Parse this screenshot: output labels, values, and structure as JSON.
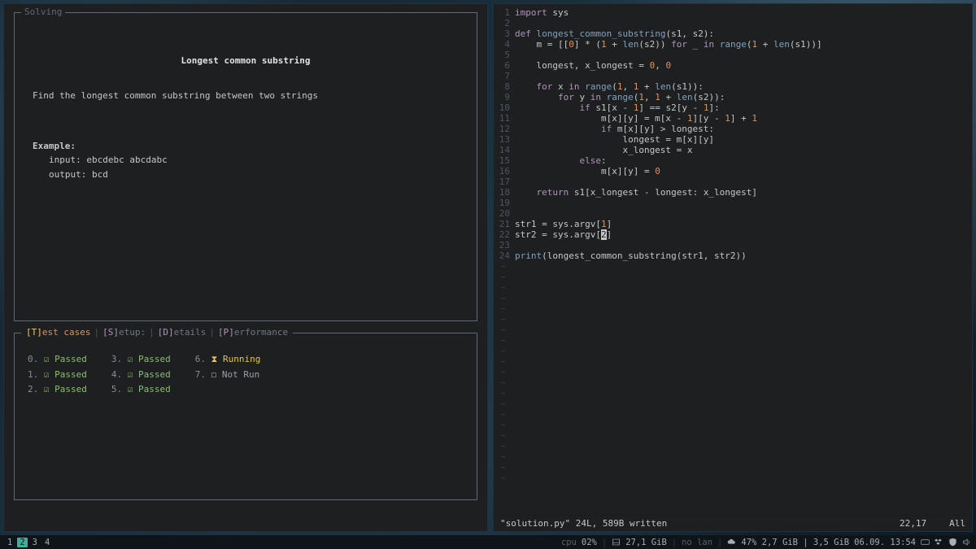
{
  "left": {
    "solving_label": "Solving",
    "title": "Longest common substring",
    "description": "Find the longest common substring between two strings",
    "example_header": "Example:",
    "example_input": "input: ebcdebc abcdabc",
    "example_output": "output: bcd",
    "tabs": [
      {
        "hotkey": "[T]",
        "label": "est cases",
        "active": true
      },
      {
        "hotkey": "[S]",
        "label": "etup:"
      },
      {
        "hotkey": "[D]",
        "label": "etails"
      },
      {
        "hotkey": "[P]",
        "label": "erformance"
      }
    ],
    "tests": [
      {
        "idx": "0.",
        "status": "pass",
        "label": "Passed"
      },
      {
        "idx": "1.",
        "status": "pass",
        "label": "Passed"
      },
      {
        "idx": "2.",
        "status": "pass",
        "label": "Passed"
      },
      {
        "idx": "3.",
        "status": "pass",
        "label": "Passed"
      },
      {
        "idx": "4.",
        "status": "pass",
        "label": "Passed"
      },
      {
        "idx": "5.",
        "status": "pass",
        "label": "Passed"
      },
      {
        "idx": "6.",
        "status": "run",
        "label": "Running"
      },
      {
        "idx": "7.",
        "status": "wait",
        "label": "Not Run"
      }
    ],
    "marks": {
      "pass": "☑",
      "run": "⧗",
      "wait": "◻"
    }
  },
  "editor": {
    "lines": [
      {
        "n": 1,
        "tokens": [
          [
            "kw",
            "import"
          ],
          [
            "op",
            " sys"
          ]
        ]
      },
      {
        "n": 2,
        "tokens": []
      },
      {
        "n": 3,
        "tokens": [
          [
            "kw",
            "def "
          ],
          [
            "fn",
            "longest_common_substring"
          ],
          [
            "op",
            "(s1, s2):"
          ]
        ]
      },
      {
        "n": 4,
        "tokens": [
          [
            "op",
            "    m = [["
          ],
          [
            "num",
            "0"
          ],
          [
            "op",
            "] * ("
          ],
          [
            "num",
            "1"
          ],
          [
            "op",
            " + "
          ],
          [
            "fn",
            "len"
          ],
          [
            "op",
            "(s2)) "
          ],
          [
            "kw",
            "for"
          ],
          [
            "op",
            " _ "
          ],
          [
            "kw",
            "in"
          ],
          [
            "op",
            " "
          ],
          [
            "fn",
            "range"
          ],
          [
            "op",
            "("
          ],
          [
            "num",
            "1"
          ],
          [
            "op",
            " + "
          ],
          [
            "fn",
            "len"
          ],
          [
            "op",
            "(s1))]"
          ]
        ]
      },
      {
        "n": 5,
        "tokens": []
      },
      {
        "n": 6,
        "tokens": [
          [
            "op",
            "    longest, x_longest = "
          ],
          [
            "num",
            "0"
          ],
          [
            "op",
            ", "
          ],
          [
            "num",
            "0"
          ]
        ]
      },
      {
        "n": 7,
        "tokens": []
      },
      {
        "n": 8,
        "tokens": [
          [
            "op",
            "    "
          ],
          [
            "kw",
            "for"
          ],
          [
            "op",
            " x "
          ],
          [
            "kw",
            "in"
          ],
          [
            "op",
            " "
          ],
          [
            "fn",
            "range"
          ],
          [
            "op",
            "("
          ],
          [
            "num",
            "1"
          ],
          [
            "op",
            ", "
          ],
          [
            "num",
            "1"
          ],
          [
            "op",
            " + "
          ],
          [
            "fn",
            "len"
          ],
          [
            "op",
            "(s1)):"
          ]
        ]
      },
      {
        "n": 9,
        "tokens": [
          [
            "op",
            "        "
          ],
          [
            "kw",
            "for"
          ],
          [
            "op",
            " y "
          ],
          [
            "kw",
            "in"
          ],
          [
            "op",
            " "
          ],
          [
            "fn",
            "range"
          ],
          [
            "op",
            "("
          ],
          [
            "num",
            "1"
          ],
          [
            "op",
            ", "
          ],
          [
            "num",
            "1"
          ],
          [
            "op",
            " + "
          ],
          [
            "fn",
            "len"
          ],
          [
            "op",
            "(s2)):"
          ]
        ]
      },
      {
        "n": 10,
        "tokens": [
          [
            "op",
            "            "
          ],
          [
            "kw",
            "if"
          ],
          [
            "op",
            " s1[x - "
          ],
          [
            "num",
            "1"
          ],
          [
            "op",
            "] == s2[y - "
          ],
          [
            "num",
            "1"
          ],
          [
            "op",
            "]:"
          ]
        ]
      },
      {
        "n": 11,
        "tokens": [
          [
            "op",
            "                m[x][y] = m[x - "
          ],
          [
            "num",
            "1"
          ],
          [
            "op",
            "][y - "
          ],
          [
            "num",
            "1"
          ],
          [
            "op",
            "] + "
          ],
          [
            "num",
            "1"
          ]
        ]
      },
      {
        "n": 12,
        "tokens": [
          [
            "op",
            "                "
          ],
          [
            "kw",
            "if"
          ],
          [
            "op",
            " m[x][y] > longest:"
          ]
        ]
      },
      {
        "n": 13,
        "tokens": [
          [
            "op",
            "                    longest = m[x][y]"
          ]
        ]
      },
      {
        "n": 14,
        "tokens": [
          [
            "op",
            "                    x_longest = x"
          ]
        ]
      },
      {
        "n": 15,
        "tokens": [
          [
            "op",
            "            "
          ],
          [
            "kw",
            "else"
          ],
          [
            "op",
            ":"
          ]
        ]
      },
      {
        "n": 16,
        "tokens": [
          [
            "op",
            "                m[x][y] = "
          ],
          [
            "num",
            "0"
          ]
        ]
      },
      {
        "n": 17,
        "tokens": []
      },
      {
        "n": 18,
        "tokens": [
          [
            "op",
            "    "
          ],
          [
            "kw",
            "return"
          ],
          [
            "op",
            " s1[x_longest - longest: x_longest]"
          ]
        ]
      },
      {
        "n": 19,
        "tokens": []
      },
      {
        "n": 20,
        "tokens": []
      },
      {
        "n": 21,
        "tokens": [
          [
            "op",
            "str1 = sys.argv["
          ],
          [
            "num",
            "1"
          ],
          [
            "op",
            "]"
          ]
        ]
      },
      {
        "n": 22,
        "tokens": [
          [
            "op",
            "str2 = sys.argv["
          ],
          [
            "cursor",
            "2"
          ],
          [
            "op",
            "]"
          ]
        ]
      },
      {
        "n": 23,
        "tokens": []
      },
      {
        "n": 24,
        "tokens": [
          [
            "fn",
            "print"
          ],
          [
            "op",
            "(longest_common_substring(str1, str2))"
          ]
        ]
      }
    ],
    "tilde_rows": 21,
    "status_left": "\"solution.py\" 24L, 589B written",
    "status_pos": "22,17",
    "status_scroll": "All"
  },
  "bar": {
    "workspaces": [
      "1",
      "2",
      "3",
      "4"
    ],
    "active_ws": "2",
    "cpu_label": "cpu",
    "cpu_val": "02%",
    "disk": "27,1 GiB",
    "nolan": "no lan",
    "net": "47%  2,7 GiB | 3,5 GiB",
    "clock": "06.09. 13:54"
  }
}
